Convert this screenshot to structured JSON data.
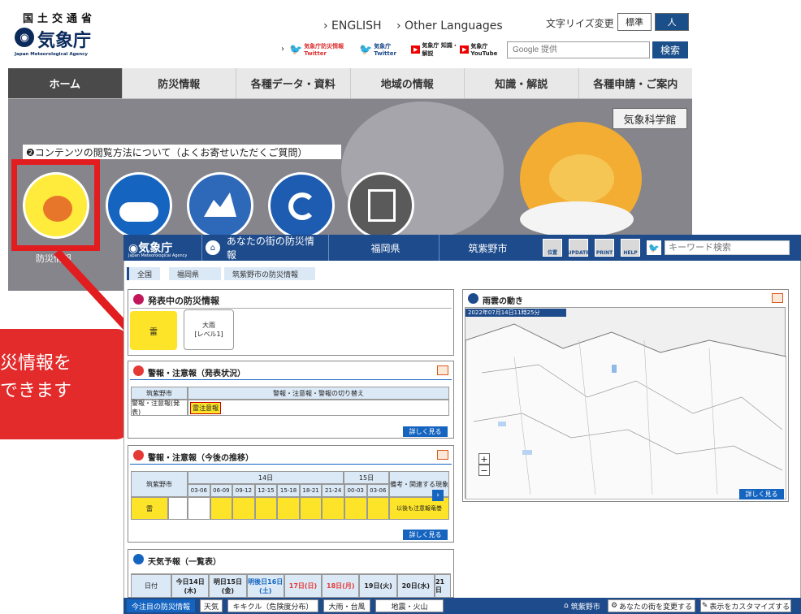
{
  "header": {
    "ministry": "国土交通省",
    "logo": "気象庁",
    "logo_en": "Japan Meteorological Agency",
    "lang_en": "› ENGLISH",
    "lang_other": "› Other Languages",
    "size_label": "文字リイズ変更",
    "size_std": "標準",
    "size_large": "人",
    "sns": [
      {
        "label": "気象庁防災情報 Twitter"
      },
      {
        "label": "気象庁 Twitter"
      },
      {
        "label": "気象庁 知識・解説"
      },
      {
        "label": "気象庁 YouTube"
      }
    ],
    "search_placeholder": "Google 提供",
    "search_button": "検索"
  },
  "nav": [
    "ホーム",
    "防災情報",
    "各種データ・資料",
    "地域の情報",
    "知識・解説",
    "各種申請・ご案内"
  ],
  "hero": {
    "faq": "❷コンテンツの閲覧方法について（よくお寄せいただくご質問）",
    "museum": "気象科学館",
    "circle_label": "防災情報"
  },
  "callout": {
    "line1": "災情報を",
    "line2": "できます"
  },
  "app": {
    "logo": "◉気象庁",
    "logo_en": "Japan Meteorological Agency",
    "tab_home": "あなたの街の防災情報",
    "tab_pref": "福岡県",
    "tab_city": "筑紫野市",
    "icons": [
      "位置",
      "UPDATE",
      "PRINT",
      "HELP"
    ],
    "keyword": "キーワード検索",
    "crumbs": [
      "全国",
      "福岡県",
      "筑紫野市の防災情報"
    ]
  },
  "panel1": {
    "title": "発表中の防災情報",
    "item1": "雷",
    "item2a": "大雨",
    "item2b": "[レベル1]"
  },
  "panel2": {
    "title": "警報・注意報（発表状況）",
    "col1": "筑紫野市",
    "col2": "警報・注意報・警報の切り替え",
    "row_label": "警報・注意報(発表)",
    "badge": "雷注意報",
    "more": "詳しく見る"
  },
  "panel3": {
    "title": "警報・注意報（今後の推移）",
    "col_city": "筑紫野市",
    "day14": "14日",
    "day15": "15日",
    "note": "備考・関連する現象",
    "times": [
      "03-06",
      "06-09",
      "09-12",
      "12-15",
      "15-18",
      "18-21",
      "21-24",
      "00-03",
      "03-06"
    ],
    "row_label": "雷",
    "row_note": "以後も注意報竜巻",
    "more": "詳しく見る"
  },
  "panel4": {
    "title": "天気予報（一覧表）",
    "date_label": "日付",
    "days": [
      "今日14日(木)",
      "明日15日(金)",
      "明後日16日(土)",
      "17日(日)",
      "18日(月)",
      "19日(火)",
      "20日(水)",
      "21日"
    ]
  },
  "map": {
    "title": "雨雲の動き",
    "timestamp": "2022年07月14日11時25分",
    "more": "詳しく見る",
    "zoom_in": "+",
    "zoom_out": "−"
  },
  "bottom": {
    "items": [
      "今注目の防災情報",
      "天気",
      "キキクル（危険度分布）",
      "大雨・台風",
      "地震・火山"
    ],
    "city": "筑紫野市",
    "change": "あなたの街を変更する",
    "custom": "表示をカスタマイズする"
  }
}
